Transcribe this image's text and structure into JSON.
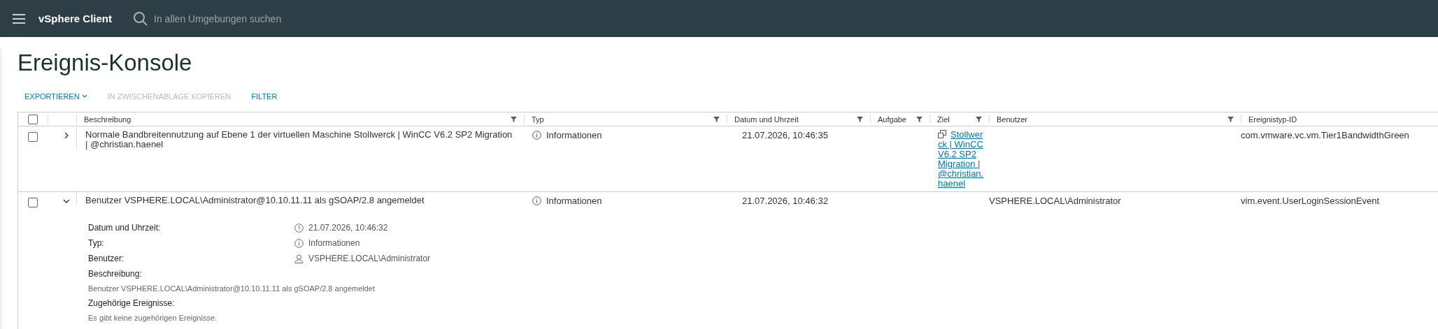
{
  "header": {
    "app_title": "vSphere Client",
    "search": {
      "placeholder": "In allen Umgebungen suchen"
    }
  },
  "page_title": "Ereignis-Konsole",
  "toolbar": [
    {
      "label": "EXPORTIEREN",
      "disabled": false,
      "dropdown": true
    },
    {
      "label": "IN ZWISCHENABLAGE KOPIEREN",
      "disabled": true,
      "dropdown": false
    },
    {
      "label": "FILTER",
      "disabled": false,
      "dropdown": false
    }
  ],
  "table": {
    "select_all_checked": false,
    "columns": [
      {
        "label": "Beschreibung",
        "filterable": true
      },
      {
        "label": "Typ",
        "filterable": true
      },
      {
        "label": "Datum und Uhrzeit",
        "filterable": true
      },
      {
        "label": "Aufgabe",
        "filterable": true
      },
      {
        "label": "Ziel",
        "filterable": true
      },
      {
        "label": "Benutzer",
        "filterable": true
      },
      {
        "label": "Ereignistyp-ID",
        "filterable": false
      }
    ],
    "rows": [
      {
        "checked": false,
        "expanded": false,
        "description": "Normale Bandbreitennutzung auf Ebene 1 der virtuellen Maschine Stollwerck | WinCC V6.2 SP2 Migration | @christian.haenel",
        "type": "Informationen",
        "datetime": "21.07.2026, 10:46:35",
        "target": "Stollwerck | WinCC V6.2 SP2 Migration | @christian.haenel",
        "event_type_id": "com.vmware.vc.vm.Tier1BandwidthGreen"
      },
      {
        "checked": false,
        "expanded": true,
        "description": "Benutzer VSPHERE.LOCAL\\Administrator@10.10.11.11 als gSOAP/2.8 angemeldet",
        "type": "Informationen",
        "datetime": "21.07.2026, 10:46:32",
        "user": "VSPHERE.LOCAL\\Administrator",
        "event_type_id": "vim.event.UserLoginSessionEvent",
        "details": {
          "fields": [
            {
              "kind": "clock",
              "label": "Datum und Uhrzeit:",
              "value": "21.07.2026, 10:46:32"
            },
            {
              "kind": "info",
              "label": "Typ:",
              "value": "Informationen"
            },
            {
              "kind": "user",
              "label": "Benutzer:",
              "value": "VSPHERE.LOCAL\\Administrator"
            }
          ],
          "sections": [
            {
              "label": "Beschreibung:",
              "text": "Benutzer VSPHERE.LOCAL\\Administrator@10.10.11.11 als gSOAP/2.8 angemeldet"
            },
            {
              "label": "Zugehörige Ereignisse:",
              "text": "Es gibt keine zugehörigen Ereignisse."
            }
          ]
        }
      }
    ]
  }
}
